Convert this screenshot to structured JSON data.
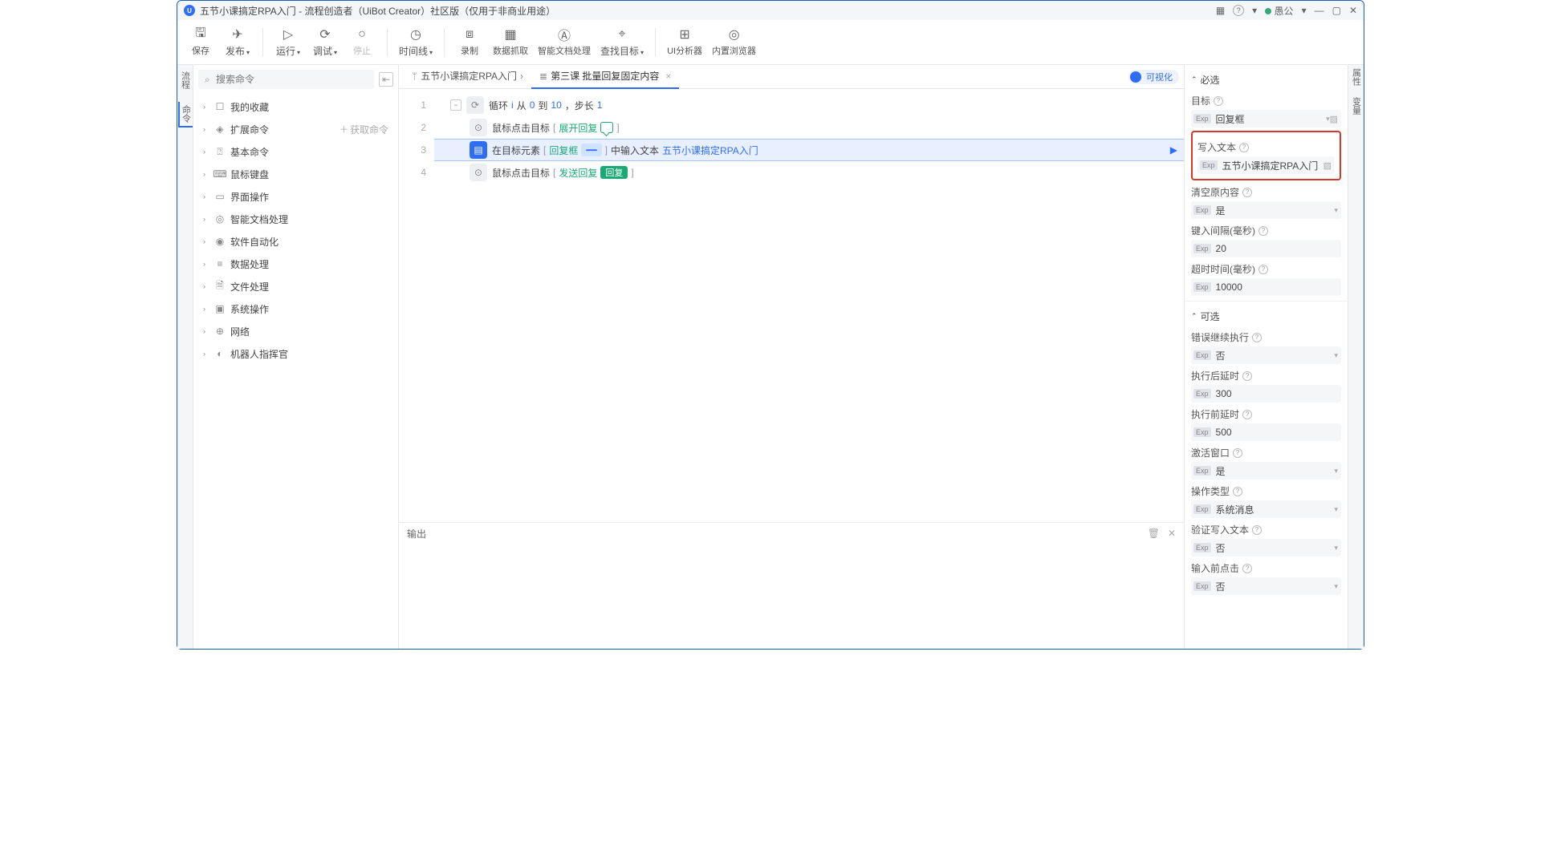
{
  "titlebar": {
    "title": "五节小课搞定RPA入门 - 流程创造者（UiBot Creator）社区版（仅用于非商业用途）",
    "user": "愚公"
  },
  "toolbar": {
    "save": "保存",
    "publish": "发布",
    "run": "运行",
    "debug": "调试",
    "stop": "停止",
    "timeline": "时间线",
    "record": "录制",
    "capture": "数据抓取",
    "docai": "智能文档处理",
    "findtarget": "查找目标",
    "uianalyzer": "UI分析器",
    "browser": "内置浏览器"
  },
  "search": {
    "placeholder": "搜索命令"
  },
  "sidebar": {
    "items": [
      {
        "label": "我的收藏",
        "icon": "☐"
      },
      {
        "label": "扩展命令",
        "icon": "◈",
        "extra": "获取命令"
      },
      {
        "label": "基本命令",
        "icon": "⍰"
      },
      {
        "label": "鼠标键盘",
        "icon": "⌨"
      },
      {
        "label": "界面操作",
        "icon": "▭"
      },
      {
        "label": "智能文档处理",
        "icon": "◎"
      },
      {
        "label": "软件自动化",
        "icon": "◉"
      },
      {
        "label": "数据处理",
        "icon": "≡"
      },
      {
        "label": "文件处理",
        "icon": "🗎"
      },
      {
        "label": "系统操作",
        "icon": "▣"
      },
      {
        "label": "网络",
        "icon": "⊕"
      },
      {
        "label": "机器人指挥官",
        "icon": "◐"
      }
    ]
  },
  "tabs": {
    "crumb": "五节小课搞定RPA入门",
    "active": "第三课 批量回复固定内容",
    "visual": "可视化"
  },
  "lines": {
    "l1": {
      "a": "循环",
      "b": "i",
      "c": "从",
      "d": "0",
      "e": "到",
      "f": "10",
      "g": "，步长",
      "h": "1"
    },
    "l2": {
      "a": "鼠标点击目标",
      "b": "[",
      "c": "展开回复",
      "d": "]"
    },
    "l3": {
      "a": "在目标元素",
      "b": "[",
      "c": "回复框",
      "d": "]",
      "e": "中输入文本",
      "f": "五节小课搞定RPA入门"
    },
    "l4": {
      "a": "鼠标点击目标",
      "b": "[",
      "c": "发送回复",
      "d": "回复",
      "e": "]"
    }
  },
  "output": {
    "title": "输出"
  },
  "props": {
    "required": "必选",
    "optional": "可选",
    "target": {
      "label": "目标",
      "value": "回复框"
    },
    "text": {
      "label": "写入文本",
      "value": "五节小课搞定RPA入门"
    },
    "clear": {
      "label": "清空原内容",
      "value": "是"
    },
    "interval": {
      "label": "键入间隔(毫秒)",
      "value": "20"
    },
    "timeout": {
      "label": "超时时间(毫秒)",
      "value": "10000"
    },
    "errcont": {
      "label": "错误继续执行",
      "value": "否"
    },
    "delayafter": {
      "label": "执行后延时",
      "value": "300"
    },
    "delaybefore": {
      "label": "执行前延时",
      "value": "500"
    },
    "activate": {
      "label": "激活窗口",
      "value": "是"
    },
    "optype": {
      "label": "操作类型",
      "value": "系统消息"
    },
    "validate": {
      "label": "验证写入文本",
      "value": "否"
    },
    "preclick": {
      "label": "输入前点击",
      "value": "否"
    }
  }
}
